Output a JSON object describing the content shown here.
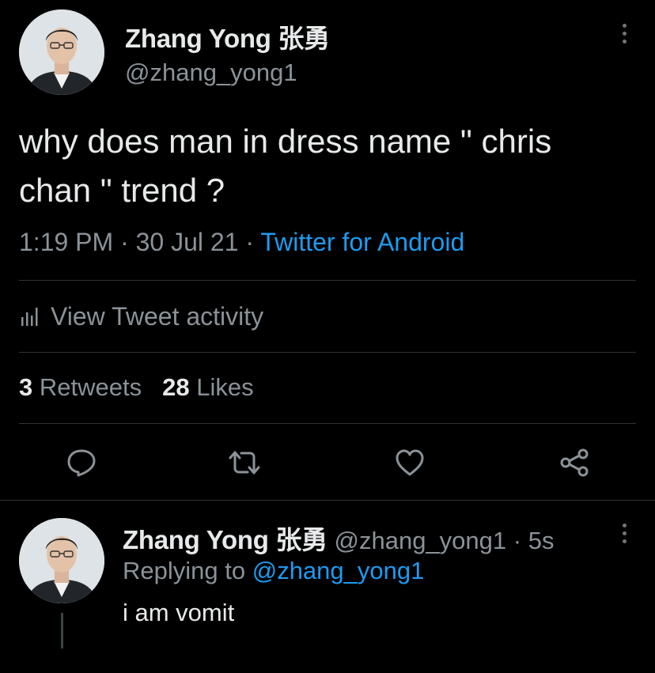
{
  "tweet": {
    "author": {
      "name": "Zhang Yong 张勇",
      "handle": "@zhang_yong1"
    },
    "text": "why does man in dress name \" chris chan \" trend ?",
    "time": "1:19 PM",
    "date": "30 Jul 21",
    "source": "Twitter for Android",
    "activity_label": "View Tweet activity",
    "retweets_count": "3",
    "retweets_label": "Retweets",
    "likes_count": "28",
    "likes_label": "Likes"
  },
  "reply": {
    "author": {
      "name": "Zhang Yong 张勇",
      "handle": "@zhang_yong1"
    },
    "age": "5s",
    "replying_prefix": "Replying to",
    "replying_to": "@zhang_yong1",
    "text": "i am vomit"
  },
  "icons": [
    "avatar",
    "more-icon",
    "activity-chart-icon",
    "reply-icon",
    "retweet-icon",
    "like-icon",
    "share-icon"
  ],
  "colors": {
    "background": "#000000",
    "text": "#e7e9ea",
    "muted": "#8b9298",
    "link": "#1d9bf0",
    "divider": "#2f3336"
  }
}
